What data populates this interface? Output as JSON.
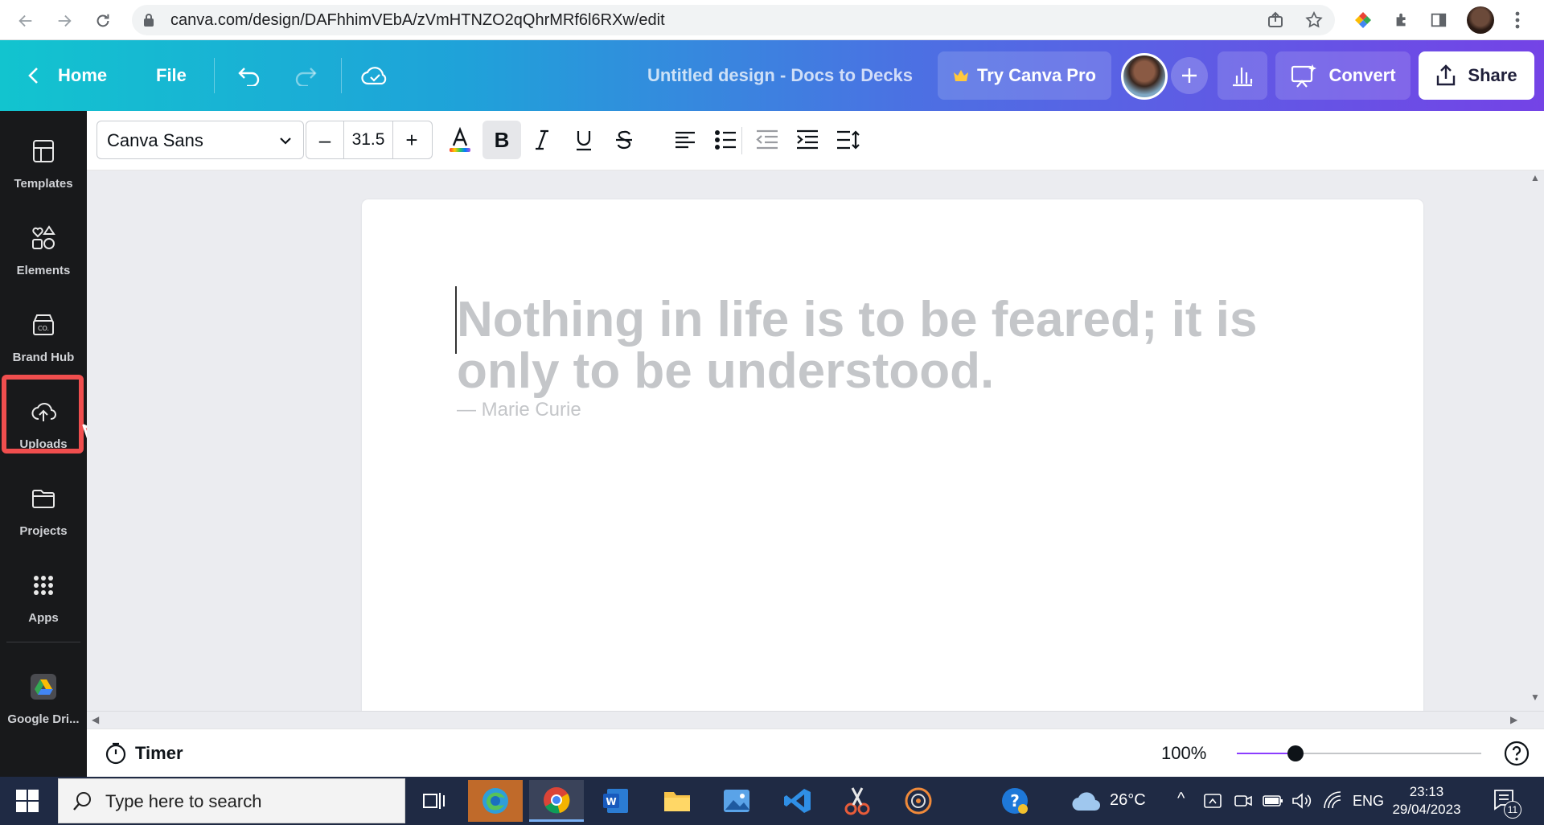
{
  "browser": {
    "url": "canva.com/design/DAFhhimVEbA/zVmHTNZO2qQhrMRf6l6RXw/edit"
  },
  "header": {
    "home_label": "Home",
    "file_label": "File",
    "doc_title": "Untitled design - Docs to Decks",
    "try_pro_label": "Try Canva Pro",
    "convert_label": "Convert",
    "share_label": "Share"
  },
  "sidebar": {
    "items": [
      {
        "label": "Templates",
        "icon": "templates-icon"
      },
      {
        "label": "Elements",
        "icon": "elements-icon"
      },
      {
        "label": "Brand Hub",
        "icon": "brand-hub-icon"
      },
      {
        "label": "Uploads",
        "icon": "upload-cloud-icon"
      },
      {
        "label": "Projects",
        "icon": "folder-icon"
      },
      {
        "label": "Apps",
        "icon": "apps-grid-icon"
      },
      {
        "label": "Google Dri...",
        "icon": "google-drive-icon"
      }
    ],
    "highlighted_item": "Uploads"
  },
  "toolbar": {
    "font_family": "Canva Sans",
    "font_size": "31.5",
    "decrease_label": "–",
    "increase_label": "+"
  },
  "canvas": {
    "quote": "Nothing in life is to be feared; it is only to be understood.",
    "author": "— Marie Curie"
  },
  "bottombar": {
    "timer_label": "Timer",
    "zoom_label": "100%",
    "zoom_fraction": 0.24
  },
  "taskbar": {
    "search_placeholder": "Type here to search",
    "weather": "26°C",
    "language": "ENG",
    "time": "23:13",
    "date": "29/04/2023",
    "notification_count": "11"
  },
  "colors": {
    "header_gradient_start": "#12c4cf",
    "header_gradient_end": "#7443e6",
    "sidebar_bg": "#18191b",
    "highlight": "#f04e4e",
    "quote_text": "#c4c6c9"
  }
}
